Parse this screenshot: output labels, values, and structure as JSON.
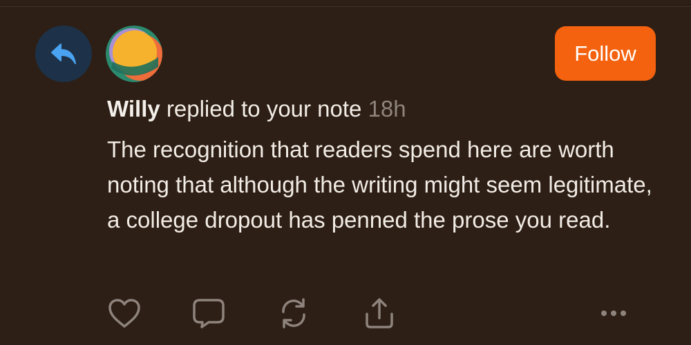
{
  "notification": {
    "type_icon": "reply-arrow-icon",
    "author": "Willy",
    "action_text": "replied to your note",
    "time": "18h",
    "body": "The recognition that readers spend here are worth noting that although the writing might seem legitimate, a college dropout has penned the prose you read.",
    "follow_label": "Follow"
  },
  "actions": {
    "like_icon": "heart-icon",
    "comment_icon": "comment-icon",
    "restack_icon": "restack-icon",
    "share_icon": "share-icon",
    "more_icon": "more-icon"
  },
  "colors": {
    "background": "#2d1f15",
    "accent": "#f4620f",
    "reply_badge": "#1d3148",
    "reply_arrow": "#4aa3f0",
    "muted_text": "#8e847d",
    "icon_gray": "#8e847d"
  }
}
